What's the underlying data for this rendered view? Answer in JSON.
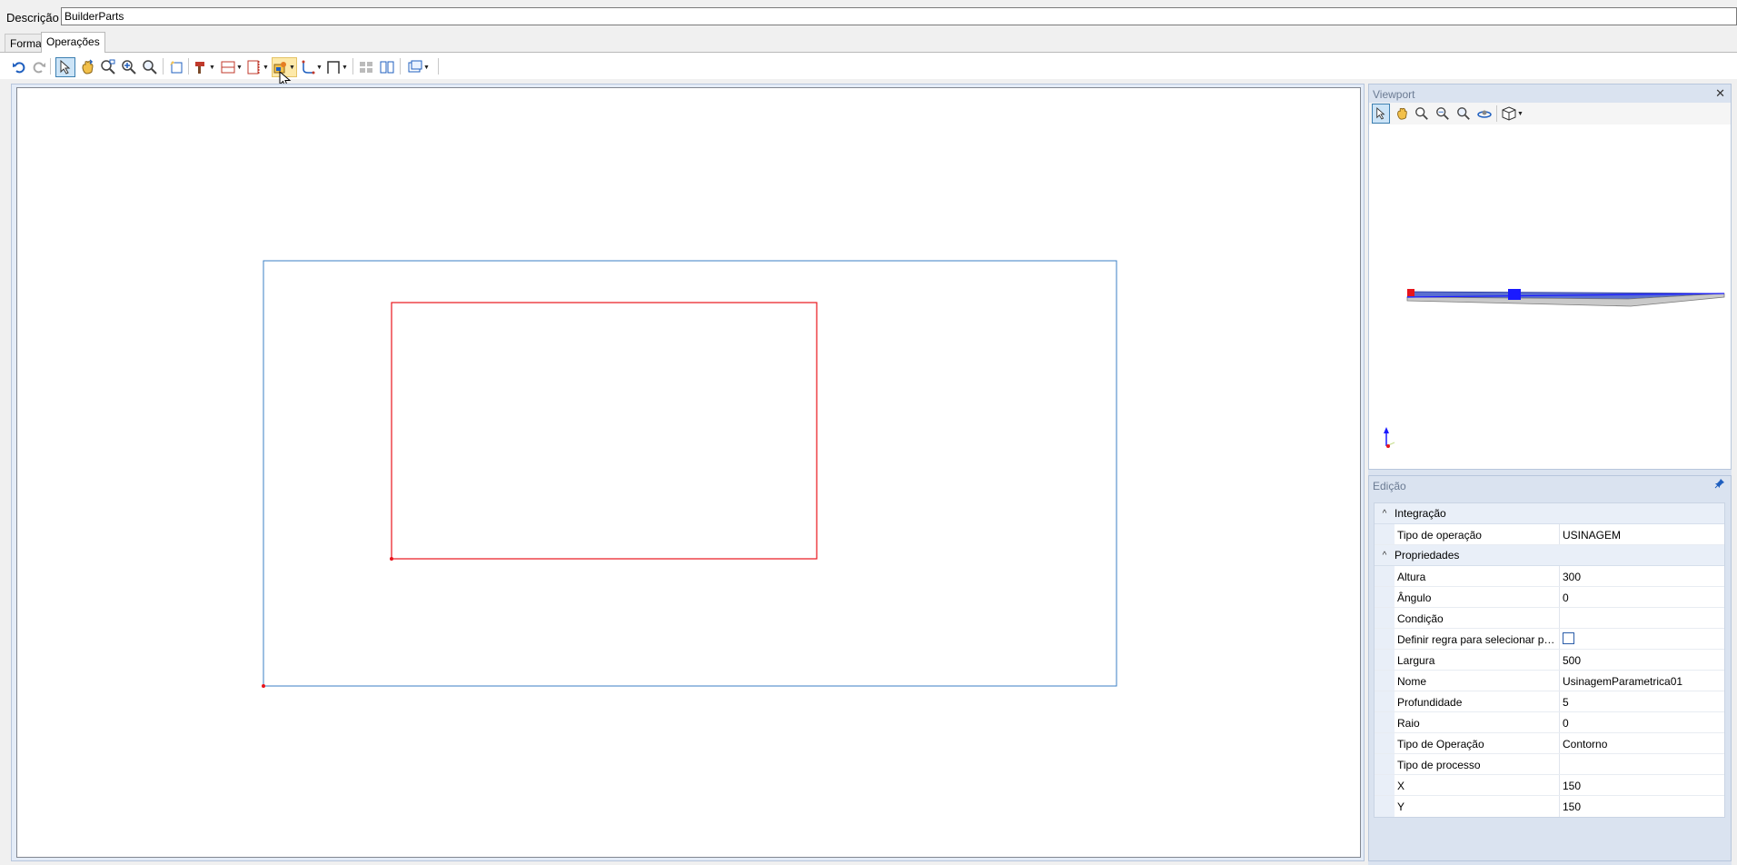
{
  "description": {
    "label": "Descrição",
    "value": "BuilderParts"
  },
  "tabs": [
    {
      "label": "Forma",
      "active": false
    },
    {
      "label": "Operações",
      "active": true
    }
  ],
  "toolbar": {
    "buttons": [
      "undo-icon",
      "redo-icon",
      "select-icon",
      "pan-icon",
      "zoom-window-icon",
      "zoom-in-icon",
      "zoom-fit-icon",
      "note-icon",
      "drill-icon",
      "groove-icon",
      "panel-icon",
      "machining-icon",
      "contour-icon",
      "frame-icon",
      "grid-icon",
      "split-icon",
      "view-icon"
    ]
  },
  "viewport": {
    "title": "Viewport",
    "close": "✕"
  },
  "edicao": {
    "title": "Edição",
    "pin": "📌",
    "categories": [
      {
        "label": "Integração",
        "toggle": "^",
        "rows": [
          {
            "name": "Tipo de operação",
            "value": "USINAGEM"
          }
        ]
      },
      {
        "label": "Propriedades",
        "toggle": "^",
        "rows": [
          {
            "name": "Altura",
            "value": "300"
          },
          {
            "name": "Ângulo",
            "value": "0"
          },
          {
            "name": "Condição",
            "value": ""
          },
          {
            "name": "Definir regra para selecionar proc...",
            "value": "",
            "checkbox": true
          },
          {
            "name": "Largura",
            "value": "500"
          },
          {
            "name": "Nome",
            "value": "UsinagemParametrica01"
          },
          {
            "name": "Profundidade",
            "value": "5"
          },
          {
            "name": "Raio",
            "value": "0"
          },
          {
            "name": "Tipo de Operação",
            "value": "Contorno"
          },
          {
            "name": "Tipo de processo",
            "value": ""
          },
          {
            "name": "X",
            "value": "150"
          },
          {
            "name": "Y",
            "value": "150"
          }
        ]
      }
    ]
  },
  "colors": {
    "panel_outline": "#3b7fc6",
    "operation_outline": "#e8141c",
    "origin_marker": "#e8141c",
    "viewport_marker": "#1a1aff"
  }
}
